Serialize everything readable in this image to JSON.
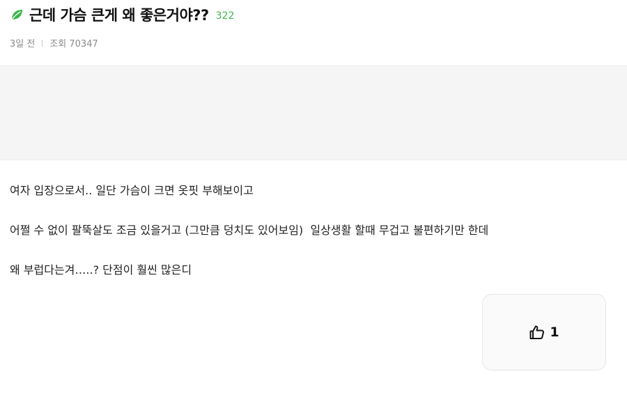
{
  "post": {
    "title": "근데 가슴 큰게 왜 좋은거야??",
    "comment_count": "322",
    "leaf_icon": "leaf-icon",
    "time_ago": "3일 전",
    "views": "조회 70347"
  },
  "body": {
    "lines": [
      "여자 입장으로서.. 일단 가슴이 크면 옷핏 부해보이고",
      "어쩔 수 없이 팔뚝살도 조금 있을거고 (그만큼 덩치도 있어보임)  일상생활 할때 무겁고 불편하기만 한데",
      "왜 부럽다는겨…..? 단점이 훨씬 많은디"
    ]
  },
  "like": {
    "icon": "thumbs-up-icon",
    "count": "1"
  },
  "colors": {
    "accent_green": "#3cb44a",
    "ad_background": "#f5f5f5",
    "meta_text": "#8a8a8a"
  }
}
